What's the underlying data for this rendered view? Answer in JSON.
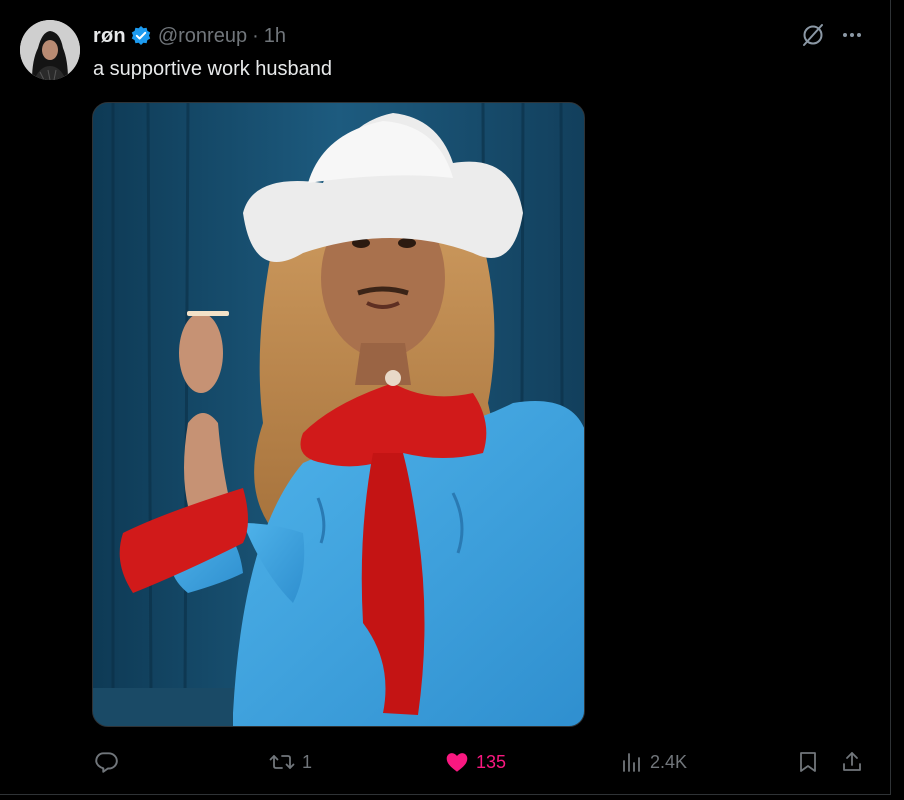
{
  "tweet": {
    "author": {
      "display_name": "røn",
      "handle": "@ronreup",
      "verified": true
    },
    "separator": "·",
    "time": "1h",
    "text": "a supportive work husband"
  },
  "header_icons": {
    "grok": "grok-icon",
    "more": "more-icon"
  },
  "actions": {
    "replies": "",
    "retweets": "1",
    "likes": "135",
    "views": "2.4K"
  },
  "colors": {
    "background": "#000000",
    "text_primary": "#e7e9ea",
    "text_secondary": "#71767b",
    "verified_blue": "#1d9bf0",
    "like_pink": "#f91880"
  }
}
